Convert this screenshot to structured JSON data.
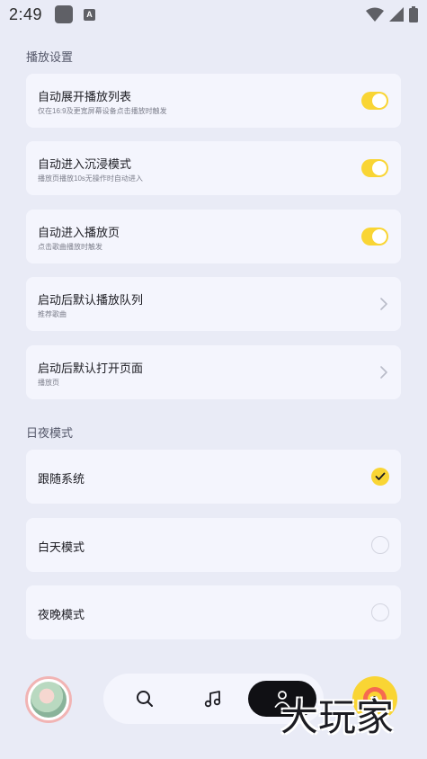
{
  "status_bar": {
    "time": "2:49",
    "app_badge": "A"
  },
  "playback_section": {
    "title": "播放设置",
    "items": [
      {
        "title": "自动展开播放列表",
        "desc": "仅在16:9及更宽屏幕设备点击播放时触发",
        "control": "toggle",
        "on": true
      },
      {
        "title": "自动进入沉浸模式",
        "desc": "播放页播放10s无操作时自动进入",
        "control": "toggle",
        "on": true
      },
      {
        "title": "自动进入播放页",
        "desc": "点击歌曲播放时触发",
        "control": "toggle",
        "on": true
      },
      {
        "title": "启动后默认播放队列",
        "desc": "推荐歌曲",
        "control": "chevron"
      },
      {
        "title": "启动后默认打开页面",
        "desc": "播放页",
        "control": "chevron"
      }
    ]
  },
  "theme_section": {
    "title": "日夜模式",
    "items": [
      {
        "title": "跟随系统",
        "selected": true
      },
      {
        "title": "白天模式",
        "selected": false
      },
      {
        "title": "夜晚模式",
        "selected": false
      }
    ]
  },
  "bottom_nav": {
    "items": [
      {
        "icon": "search-icon"
      },
      {
        "icon": "music-note-icon"
      },
      {
        "icon": "user-icon",
        "active": true
      }
    ]
  },
  "watermark": {
    "text": "大玩家"
  },
  "colors": {
    "accent": "#f9d534",
    "background": "#e9ebf6",
    "card": "#f4f5fd"
  }
}
